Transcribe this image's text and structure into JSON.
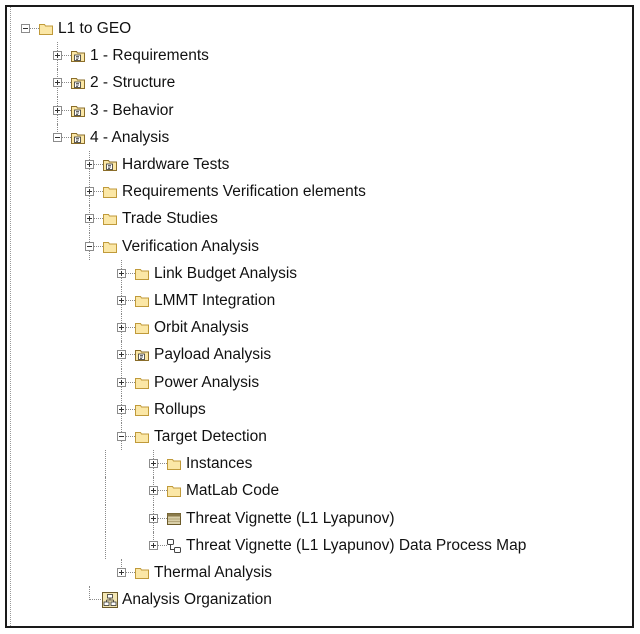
{
  "tree": {
    "items": [
      {
        "label": "L1 to GEO",
        "icon": "folder-icon",
        "depth": 0,
        "expander": "minus"
      },
      {
        "label": "1 - Requirements",
        "icon": "package-icon",
        "depth": 1,
        "expander": "plus"
      },
      {
        "label": "2 - Structure",
        "icon": "package-icon",
        "depth": 1,
        "expander": "plus"
      },
      {
        "label": "3 - Behavior",
        "icon": "package-icon",
        "depth": 1,
        "expander": "plus"
      },
      {
        "label": "4 - Analysis",
        "icon": "package-icon",
        "depth": 1,
        "expander": "minus"
      },
      {
        "label": "Hardware Tests",
        "icon": "package-icon",
        "depth": 2,
        "expander": "plus"
      },
      {
        "label": "Requirements Verification elements",
        "icon": "folder-icon",
        "depth": 2,
        "expander": "plus"
      },
      {
        "label": "Trade Studies",
        "icon": "folder-icon",
        "depth": 2,
        "expander": "plus"
      },
      {
        "label": "Verification Analysis",
        "icon": "folder-icon",
        "depth": 2,
        "expander": "minus"
      },
      {
        "label": "Link Budget Analysis",
        "icon": "folder-icon",
        "depth": 3,
        "expander": "plus"
      },
      {
        "label": "LMMT Integration",
        "icon": "folder-icon",
        "depth": 3,
        "expander": "plus"
      },
      {
        "label": "Orbit Analysis",
        "icon": "folder-icon",
        "depth": 3,
        "expander": "plus"
      },
      {
        "label": "Payload Analysis",
        "icon": "package-icon",
        "depth": 3,
        "expander": "plus"
      },
      {
        "label": "Power Analysis",
        "icon": "folder-icon",
        "depth": 3,
        "expander": "plus"
      },
      {
        "label": "Rollups",
        "icon": "folder-icon",
        "depth": 3,
        "expander": "plus"
      },
      {
        "label": "Target Detection",
        "icon": "folder-icon",
        "depth": 3,
        "expander": "minus"
      },
      {
        "label": "Instances",
        "icon": "folder-icon",
        "depth": 4,
        "expander": "plus"
      },
      {
        "label": "MatLab Code",
        "icon": "folder-icon",
        "depth": 4,
        "expander": "plus"
      },
      {
        "label": "Threat Vignette (L1 Lyapunov)",
        "icon": "diagram-icon",
        "depth": 4,
        "expander": "plus"
      },
      {
        "label": "Threat Vignette (L1 Lyapunov) Data Process Map",
        "icon": "process-map-icon",
        "depth": 4,
        "expander": "plus"
      },
      {
        "label": "Thermal Analysis",
        "icon": "folder-icon",
        "depth": 3,
        "expander": "plus"
      },
      {
        "label": "Analysis Organization",
        "icon": "organization-diagram-icon",
        "depth": 2,
        "expander": "none"
      }
    ]
  },
  "colors": {
    "folder_fill": "#fbe7a6",
    "folder_stroke": "#c09a3a",
    "package_stroke": "#8a6d2a",
    "text": "#111111",
    "frame": "#1a1a1a"
  }
}
